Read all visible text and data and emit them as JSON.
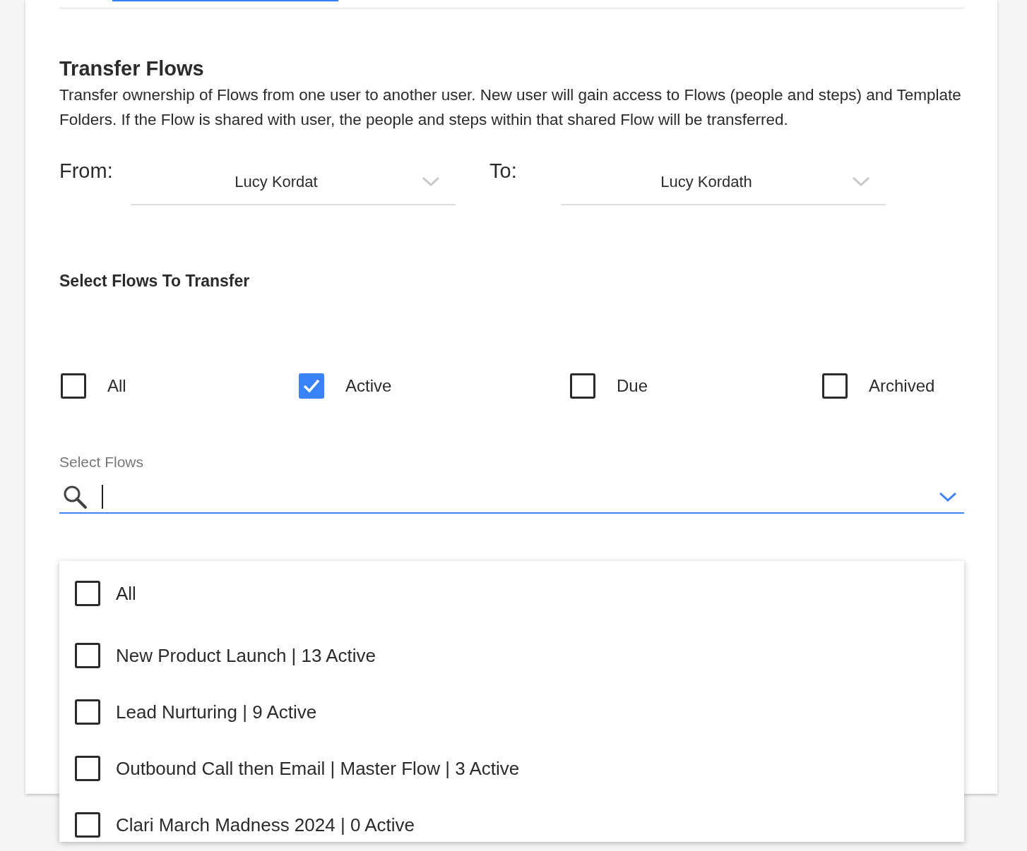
{
  "section": {
    "title": "Transfer Flows",
    "description": "Transfer ownership of Flows from one user to another user. New user will gain access to Flows (people and steps) and Template Folders. If the Flow is shared with user, the people and steps within that shared Flow will be transferred."
  },
  "users": [
    {
      "label": "From:",
      "value": "Lucy Kordat"
    },
    {
      "label": "To:",
      "value": "Lucy Kordath"
    }
  ],
  "filter_title": "Select Flows To Transfer",
  "filters": [
    {
      "label": "All",
      "checked": false
    },
    {
      "label": "Active",
      "checked": true
    },
    {
      "label": "Due",
      "checked": false
    },
    {
      "label": "Archived",
      "checked": false
    }
  ],
  "flow_select": {
    "label": "Select Flows",
    "focused": true,
    "expanded": true
  },
  "flow_options": [
    {
      "label": "All",
      "checked": false
    },
    {
      "label": "New Product Launch | 13 Active",
      "checked": false
    },
    {
      "label": "Lead Nurturing | 9 Active",
      "checked": false
    },
    {
      "label": "Outbound Call then Email | Master Flow | 3 Active",
      "checked": false
    },
    {
      "label": "Clari March Madness 2024 | 0 Active",
      "checked": false
    }
  ]
}
